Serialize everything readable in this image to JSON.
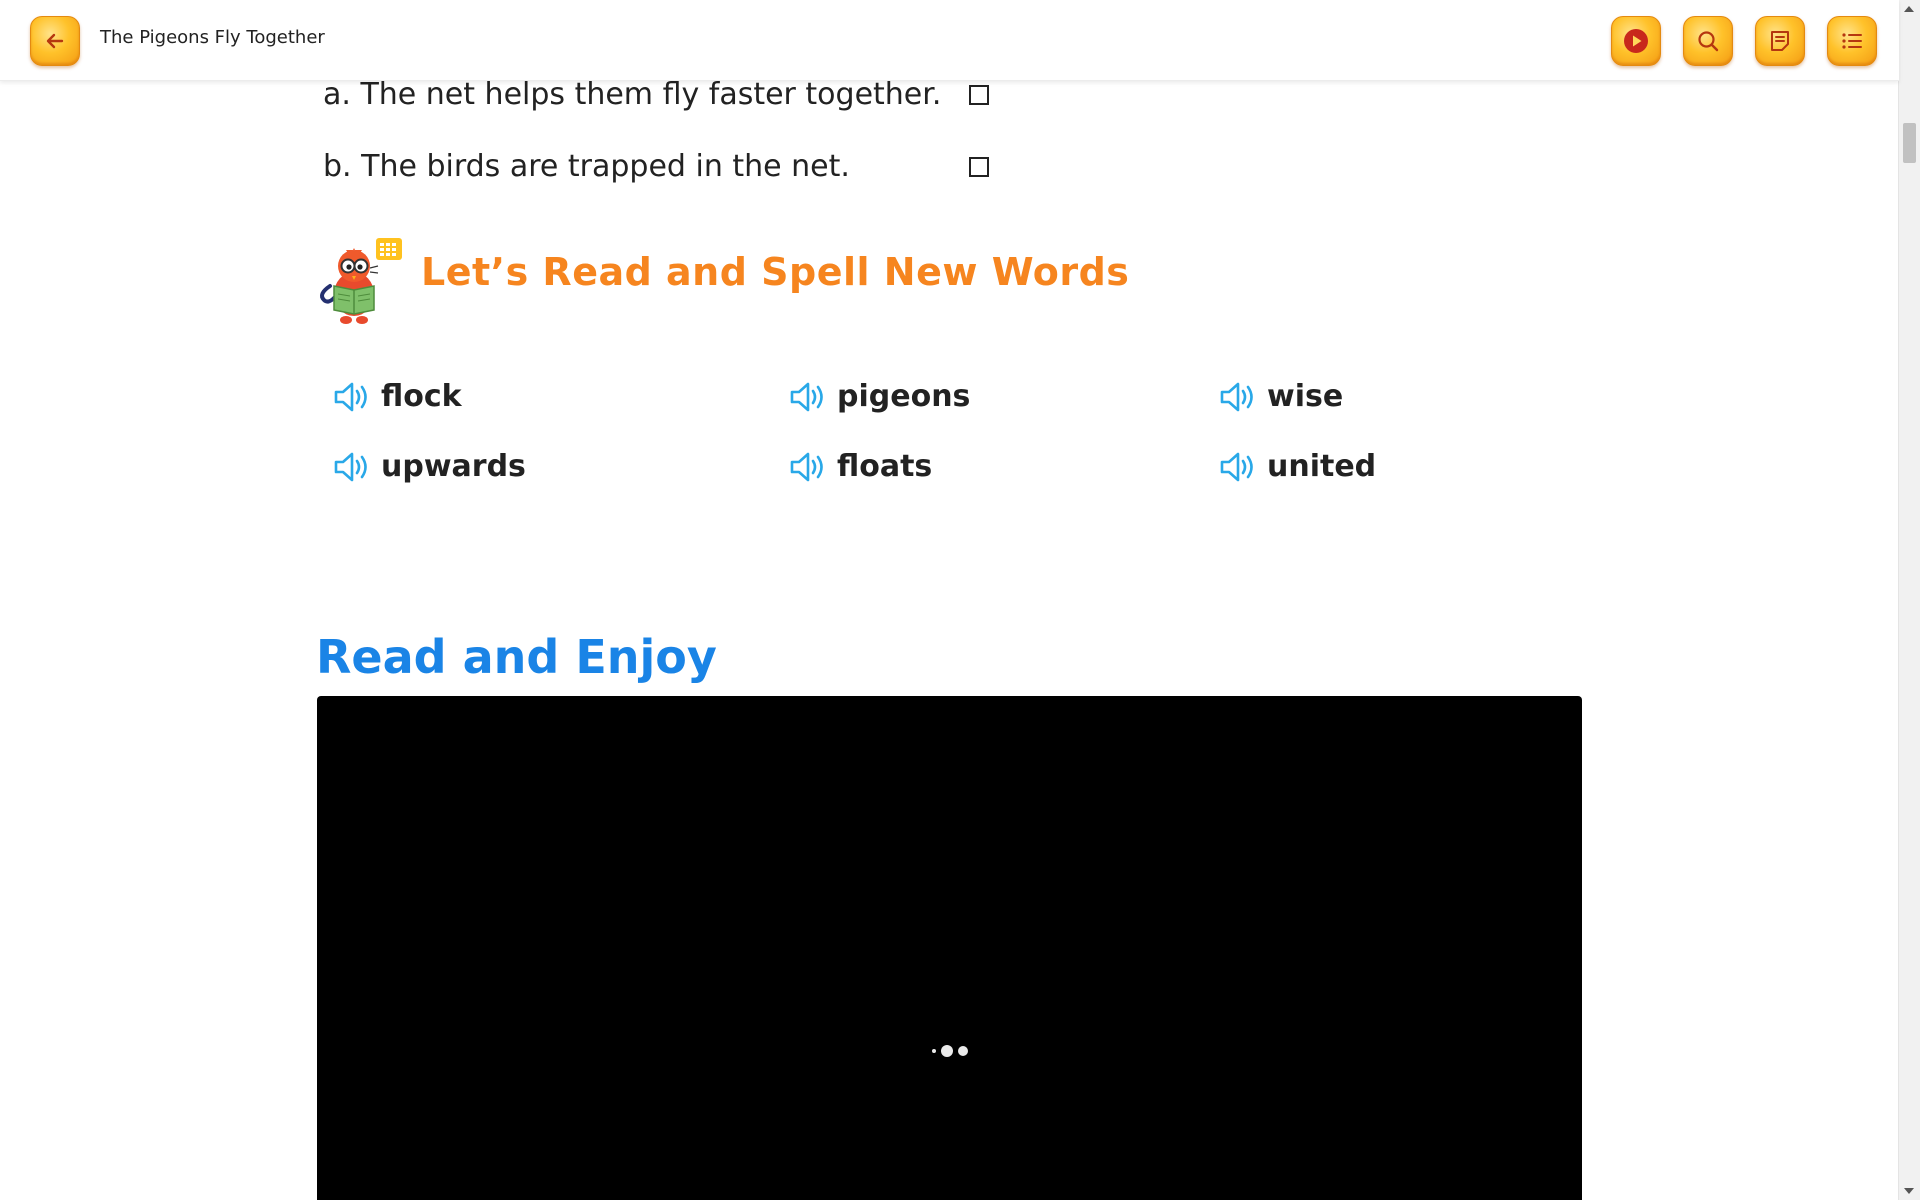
{
  "header": {
    "title": "The Pigeons Fly Together",
    "icons": [
      "back-arrow-icon",
      "play-icon",
      "search-icon",
      "notes-icon",
      "list-icon"
    ]
  },
  "quiz": {
    "options": [
      {
        "label": "a. The net helps them fly faster together.",
        "checked": false
      },
      {
        "label": "b. The birds are trapped in the net.",
        "checked": false
      }
    ]
  },
  "vocab": {
    "title": "Let’s Read and Spell New Words",
    "words": [
      "flock",
      "pigeons",
      "wise",
      "upwards",
      "floats",
      "united"
    ]
  },
  "reading": {
    "title": "Read and Enjoy"
  },
  "colors": {
    "accent_orange": "#f6851f",
    "accent_blue": "#1a84e6",
    "speaker_blue": "#29a8e8",
    "button_gold": "#ffc22a"
  }
}
